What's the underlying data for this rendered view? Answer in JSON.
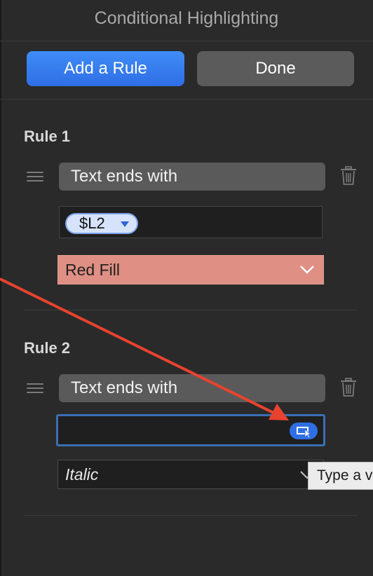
{
  "header": {
    "title": "Conditional Highlighting"
  },
  "toolbar": {
    "add_label": "Add a Rule",
    "done_label": "Done"
  },
  "rules": [
    {
      "title": "Rule 1",
      "condition": "Text ends with",
      "value_token": "$L2",
      "style": "Red Fill",
      "style_color": "#df8f84"
    },
    {
      "title": "Rule 2",
      "condition": "Text ends with",
      "value": "",
      "style": "Italic"
    }
  ],
  "tooltip": {
    "text": "Type a v"
  },
  "colors": {
    "accent": "#2f6fe6",
    "annotation_arrow": "#e8432f"
  }
}
